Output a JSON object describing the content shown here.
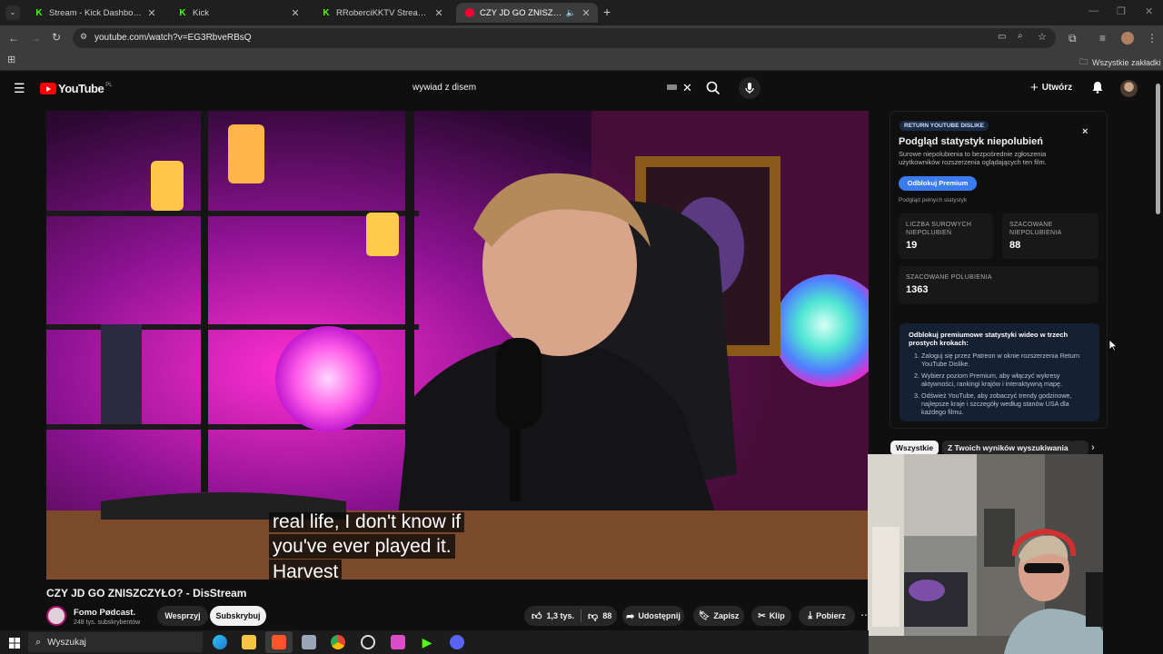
{
  "browser": {
    "tabs": [
      {
        "label": "Stream - Kick Dashboard",
        "favicon": "kick-icon"
      },
      {
        "label": "Kick",
        "favicon": "kick-icon"
      },
      {
        "label": "RRoberciKKTV Stream - Watch",
        "favicon": "kick-icon"
      },
      {
        "label": "CZY JD GO ZNISZCZYŁO? -",
        "favicon": "youtube-icon",
        "active": true
      }
    ],
    "url": "youtube.com/watch?v=EG3RbveRBsQ",
    "bookmarks_all": "Wszystkie zakładki"
  },
  "youtube": {
    "logo_text": "YouTube",
    "logo_region": "PL",
    "search_value": "wywiad z disem",
    "create_label": "Utwórz"
  },
  "video": {
    "subtitle_lines": [
      "real life, I don't know if",
      "you've ever played it.",
      "Harvest"
    ],
    "title": "CZY JD GO ZNISZCZYŁO? - DisStream",
    "channel_name": "Fomo Pødcast.",
    "subscribers": "248 tys. subskrybentów",
    "support_label": "Wesprzyj",
    "subscribe_label": "Subskrybuj",
    "likes": "1,3 tys.",
    "dislikes": "88",
    "share_label": "Udostępnij",
    "save_label": "Zapisz",
    "clip_label": "Klip",
    "download_label": "Pobierz"
  },
  "ryd": {
    "badge": "RETURN YOUTUBE DISLIKE",
    "close": "×",
    "heading": "Podgląd statystyk niepolubień",
    "desc": "Surowe niepolubienia to bezpośrednie zgłoszenia użytkowników rozszerzenia oglądających ten film.",
    "unlock_button": "Odblokuj Premium",
    "full_stats_note": "Podgląd pełnych statystyk",
    "raw_label": "LICZBA SUROWYCH NIEPOLUBIEŃ",
    "raw_value": "19",
    "est_dislikes_label": "SZACOWANE NIEPOLUBIENIA",
    "est_dislikes_value": "88",
    "est_likes_label": "SZACOWANE POLUBIENIA",
    "est_likes_value": "1363",
    "promo_title": "Odblokuj premiumowe statystyki wideo w trzech prostych krokach:",
    "steps": [
      "Zaloguj się przez Patreon w oknie rozszerzenia Return YouTube Dislike.",
      "Wybierz poziom Premium, aby włączyć wykresy aktywności, rankingi krajów i interaktywną mapę.",
      "Odśwież YouTube, aby zobaczyć trendy godzinowe, najlepsze kraje i szczegóły według stanów USA dla każdego filmu."
    ]
  },
  "chips": [
    "Wszystkie",
    "Z Twoich wyników wyszukiwania"
  ],
  "taskbar": {
    "search_label": "Wyszukaj"
  },
  "colors": {
    "yt_red": "#ff0000",
    "kick_green": "#53fc18",
    "ryd_blue": "#3ea6ff"
  }
}
